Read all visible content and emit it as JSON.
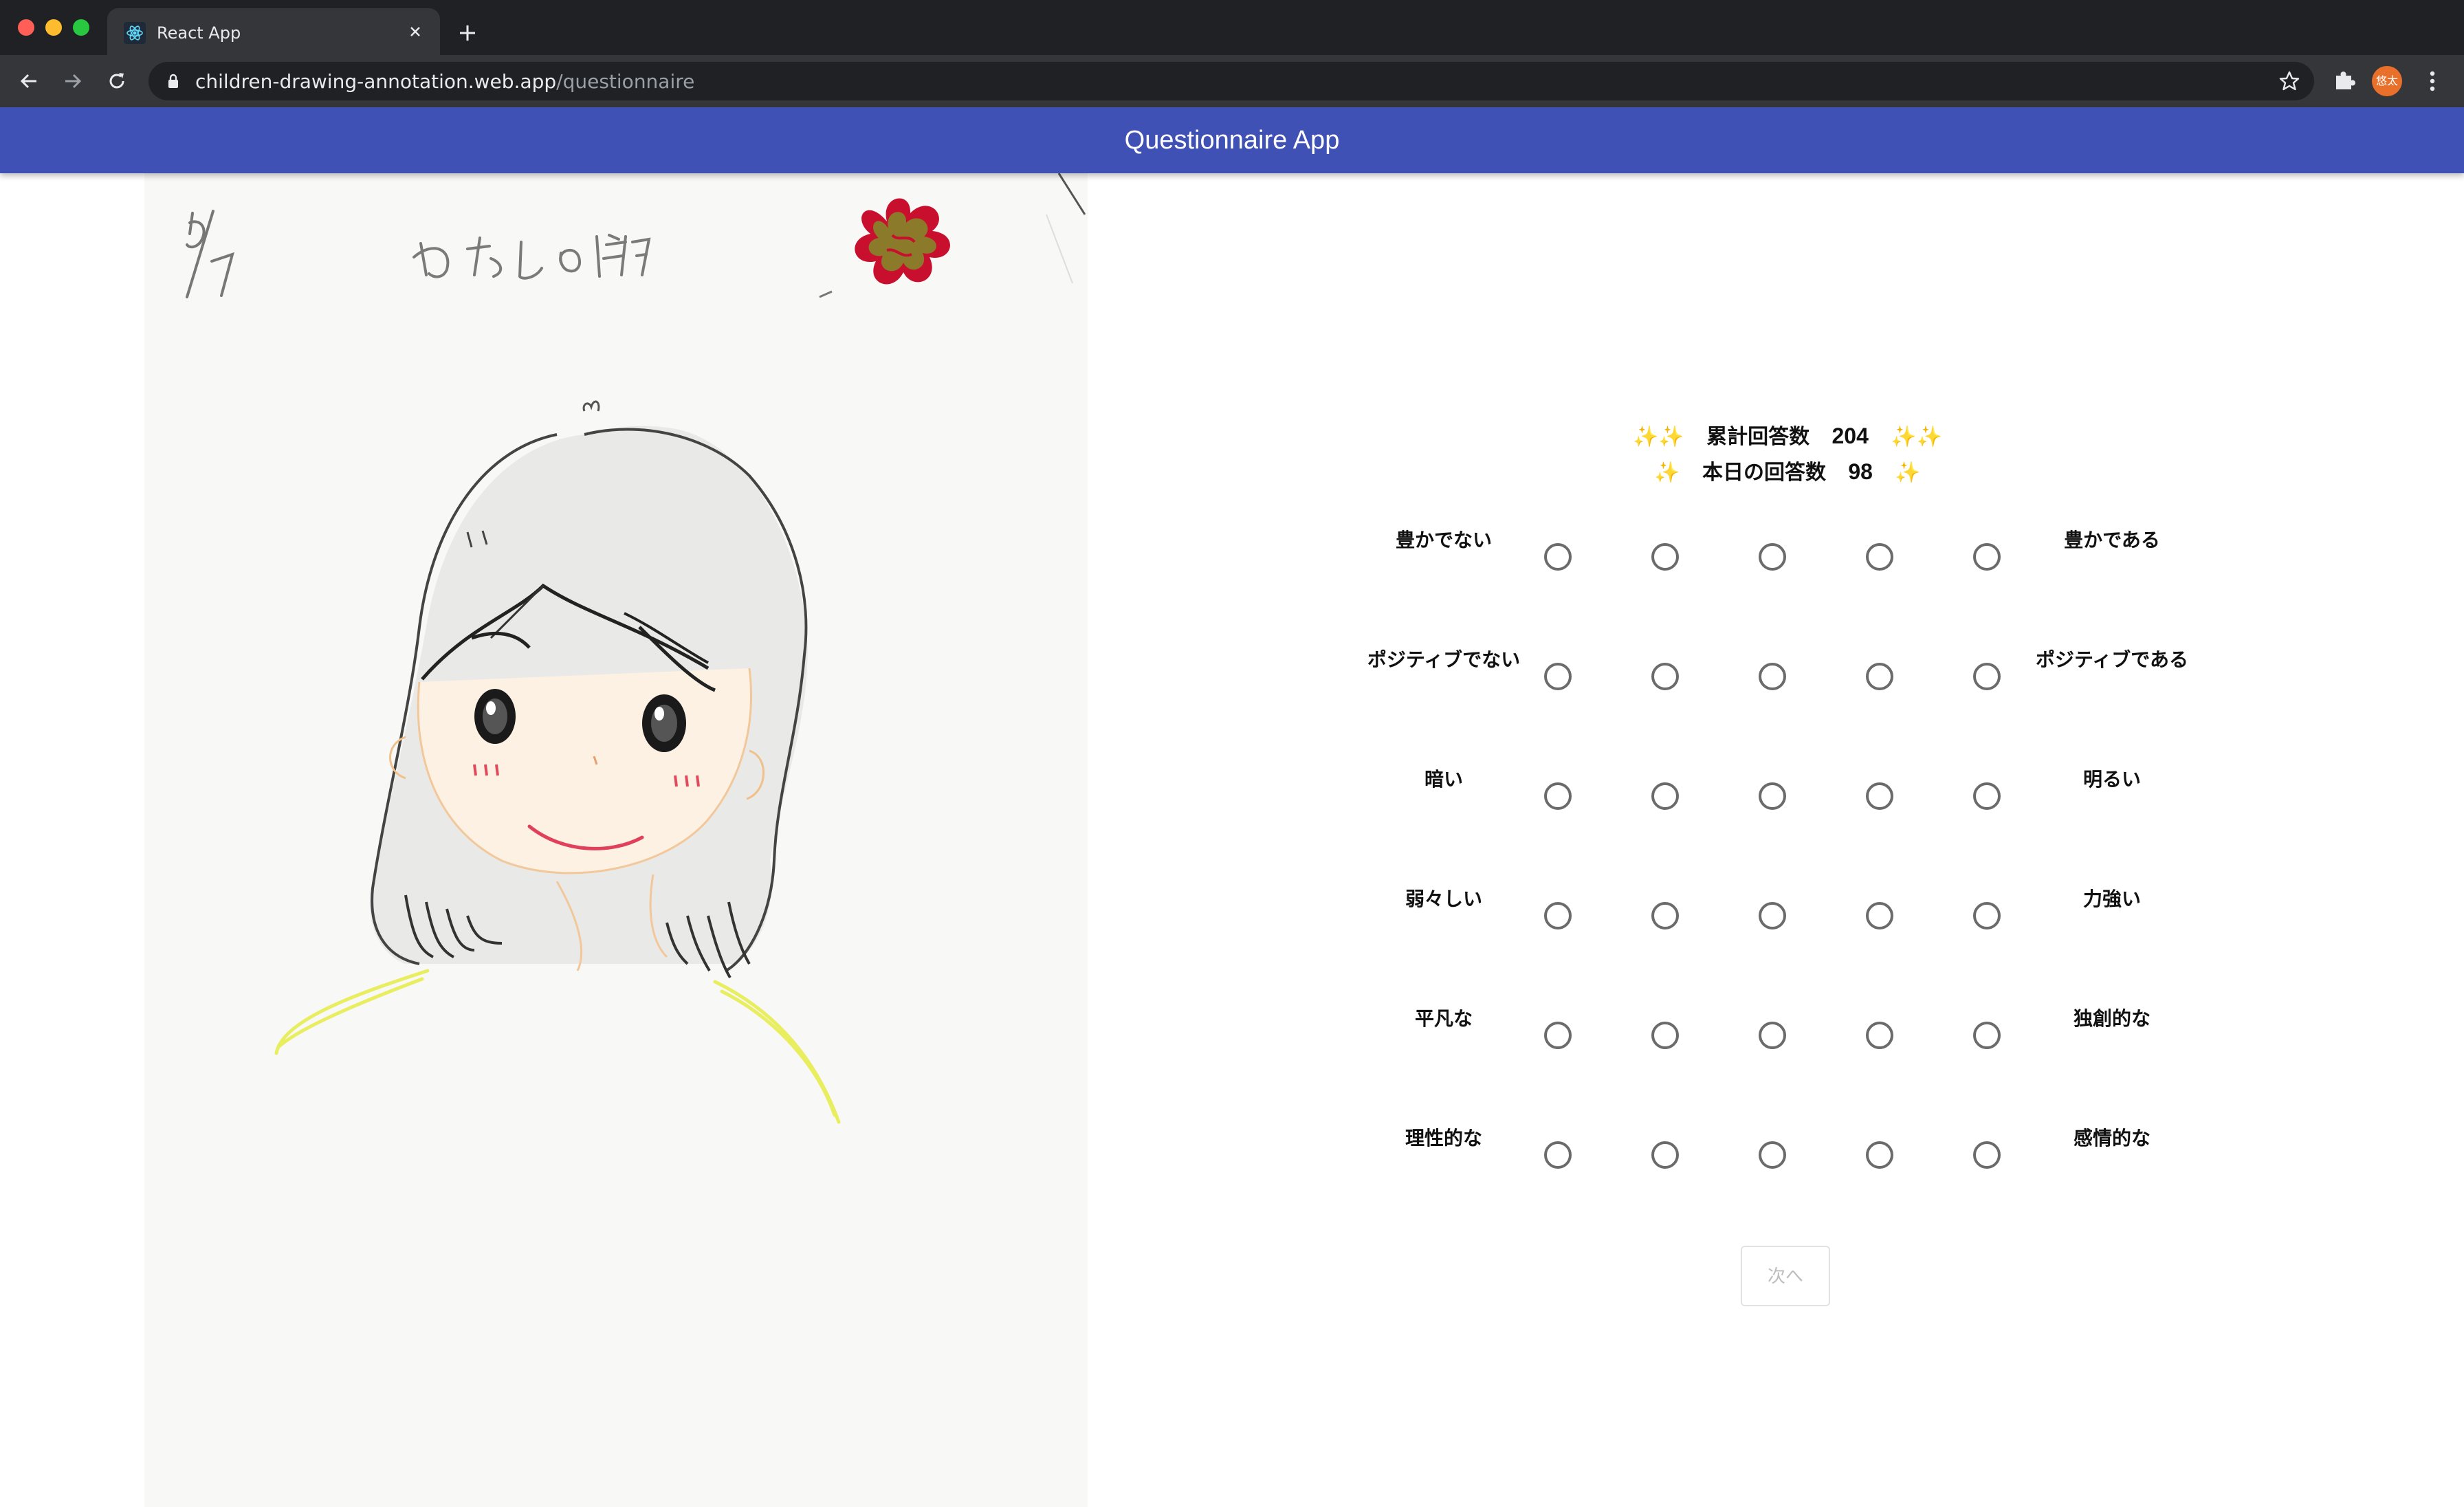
{
  "browser": {
    "tab_title": "React App",
    "url_host": "children-drawing-annotation.web.app",
    "url_path": "/questionnaire",
    "profile_initials": "悠太"
  },
  "app": {
    "title": "Questionnaire App"
  },
  "counters": {
    "total_sparkle_left": "✨✨",
    "total_label": "累計回答数",
    "total_value": "204",
    "total_sparkle_right": "✨✨",
    "today_sparkle_left": "✨",
    "today_label": "本日の回答数",
    "today_value": "98",
    "today_sparkle_right": "✨"
  },
  "drawing": {
    "date_text": "5/7",
    "title_text": "わたしの顔"
  },
  "scales": [
    {
      "left": "豊かでない",
      "right": "豊かである",
      "options": 5
    },
    {
      "left": "ポジティブでない",
      "right": "ポジティブである",
      "options": 5
    },
    {
      "left": "暗い",
      "right": "明るい",
      "options": 5
    },
    {
      "left": "弱々しい",
      "right": "力強い",
      "options": 5
    },
    {
      "left": "平凡な",
      "right": "独創的な",
      "options": 5
    },
    {
      "left": "理性的な",
      "right": "感情的な",
      "options": 5
    }
  ],
  "next_button": {
    "label": "次へ",
    "disabled": true
  },
  "colors": {
    "appbar": "#3f51b5",
    "sticker_red": "#c8102e",
    "sticker_gold": "#8a7a2a"
  }
}
